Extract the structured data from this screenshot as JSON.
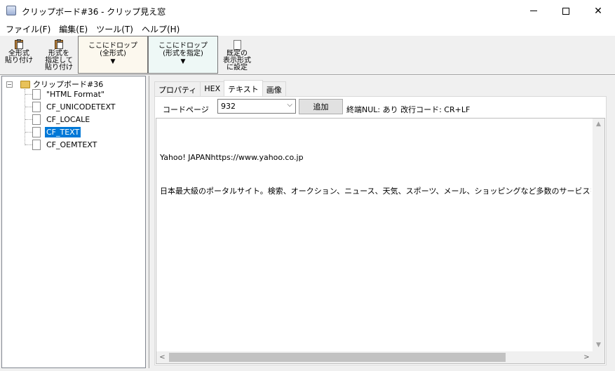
{
  "window": {
    "title": "クリップボード#36 - クリップ見え窓",
    "min_glyph": "",
    "close_glyph": "✕"
  },
  "menu": [
    {
      "label": "ファイル(F)"
    },
    {
      "label": "編集(E)"
    },
    {
      "label": "ツール(T)"
    },
    {
      "label": "ヘルプ(H)"
    }
  ],
  "toolbar": {
    "paste_all": "全形式\n貼り付け",
    "paste_format": "形式を\n指定して\n貼り付け",
    "drop_all": "ここにドロップ\n(全形式)",
    "drop_format": "ここにドロップ\n(形式を指定)",
    "default_display": "既定の\n表示形式\nに設定",
    "drop_arrow": "▼"
  },
  "tree": {
    "expander": "−",
    "root": "クリップボード#36",
    "nodes": [
      {
        "label": "\"HTML Format\"",
        "selected": false
      },
      {
        "label": "CF_UNICODETEXT",
        "selected": false
      },
      {
        "label": "CF_LOCALE",
        "selected": false
      },
      {
        "label": "CF_TEXT",
        "selected": true
      },
      {
        "label": "CF_OEMTEXT",
        "selected": false
      }
    ]
  },
  "tabs": [
    {
      "label": "プロパティ",
      "active": false
    },
    {
      "label": "HEX",
      "active": false
    },
    {
      "label": "テキスト",
      "active": true
    },
    {
      "label": "画像",
      "active": false
    }
  ],
  "text_tab": {
    "codepage_label": "コードページ",
    "codepage_value": "932",
    "add_button": "追加",
    "status": "終端NUL: あり  改行コード: CR+LF",
    "content_lines": [
      "Yahoo! JAPANhttps://www.yahoo.co.jp",
      "日本最大級のポータルサイト。検索、オークション、ニュース、天気、スポーツ、メール、ショッピングなど多数のサービスを展開。あなたの生"
    ]
  },
  "scroll": {
    "up": "▲",
    "down": "▼",
    "left": "<",
    "right": ">"
  }
}
